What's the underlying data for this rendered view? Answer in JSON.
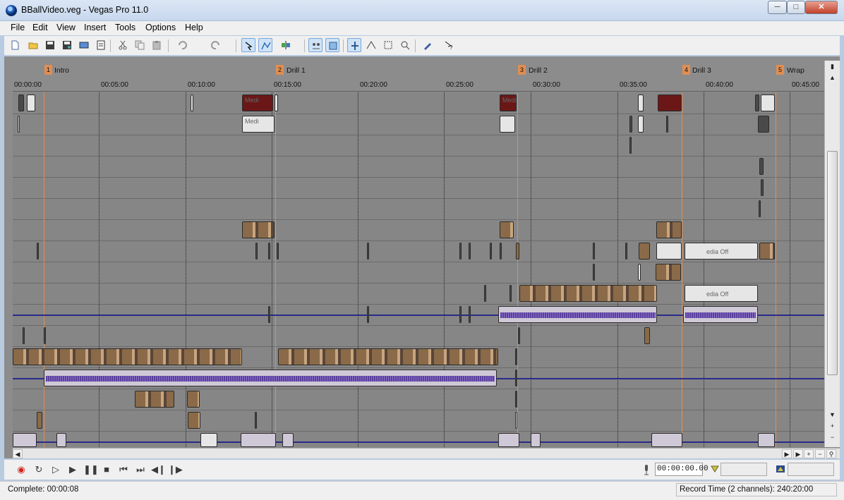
{
  "window": {
    "title": "BBallVideo.veg - Vegas Pro 11.0",
    "minimize": "─",
    "maximize": "□",
    "close": "✕"
  },
  "menu": [
    "File",
    "Edit",
    "View",
    "Insert",
    "Tools",
    "Options",
    "Help"
  ],
  "toolbar": {
    "icons": [
      "new-icon",
      "open-icon",
      "save-icon",
      "save-as-icon",
      "render-icon",
      "properties-icon",
      "cut-icon",
      "copy-icon",
      "paste-icon",
      "undo-icon",
      "redo-icon",
      "edit-tool-icon",
      "envelope-tool-icon",
      "split-icon",
      "auto-ripple-icon",
      "lock-envelopes-icon",
      "snapping-icon",
      "auto-crossfade-icon",
      "selection-tool-icon",
      "zoom-tool-icon",
      "ignore-grouping-icon",
      "help-icon"
    ]
  },
  "markers": [
    {
      "num": "1",
      "label": "Intro"
    },
    {
      "num": "2",
      "label": "Drill 1"
    },
    {
      "num": "3",
      "label": "Drill 2"
    },
    {
      "num": "4",
      "label": "Drill 3"
    },
    {
      "num": "5",
      "label": "Wrap"
    }
  ],
  "ruler": [
    "00:00:00",
    "00:05:00",
    "00:10:00",
    "00:15:00",
    "00:20:00",
    "00:25:00",
    "00:30:00",
    "00:35:00",
    "00:40:00",
    "00:45:00"
  ],
  "clip_labels": {
    "media": "Medi",
    "media_offline": "edia Off"
  },
  "transport": {
    "timecode": "00:00:00.00",
    "buttons": [
      "record-icon",
      "loop-icon",
      "play-from-start-icon",
      "play-icon",
      "pause-icon",
      "stop-icon",
      "go-to-start-icon",
      "go-to-end-icon",
      "previous-frame-icon",
      "next-frame-icon"
    ]
  },
  "status": {
    "left": "Complete: 00:00:08",
    "right": "Record Time (2 channels): 240:20:00"
  },
  "colors": {
    "marker": "#e08e52",
    "timeline_bg": "#868686",
    "audio_waveform": "#5a3f9e",
    "offline_clip": "#6b1717"
  }
}
